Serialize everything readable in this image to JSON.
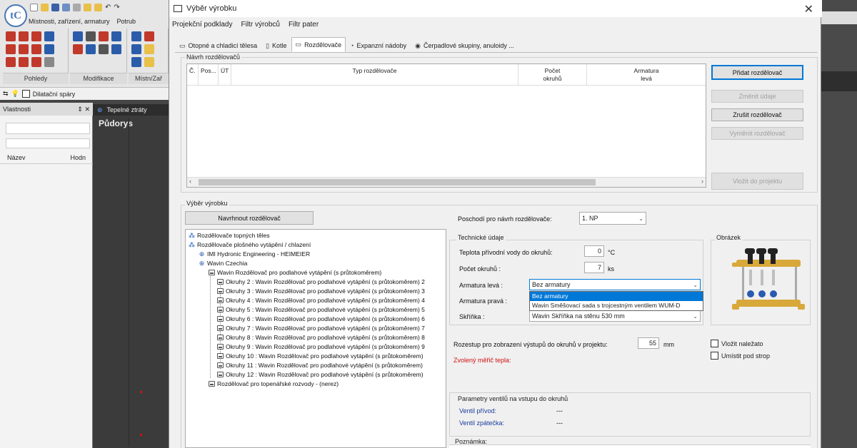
{
  "bg_app": {
    "logo_text": "tC",
    "ribbon_tabs": [
      "Místnosti, zařízení, armatury",
      "Potrub"
    ],
    "ribbon_groups": [
      "Pohledy",
      "Modifikace",
      "Místn/Zař"
    ],
    "toolbar_text": "Dilatační spáry",
    "properties_title": "Vlastnosti",
    "properties_controls": "⇕ ✕",
    "col_name": "Název",
    "col_value": "Hodn",
    "canvas_tab": "Tepelné ztráty",
    "canvas_title": "Půdorys"
  },
  "dialog": {
    "title": "Výběr výrobku",
    "close": "✕",
    "menu": [
      "Projekční podklady",
      "Filtr výrobců",
      "Filtr pater"
    ],
    "tabs": [
      {
        "label": "Otopné a chladicí tělesa",
        "icon": "radiator-icon"
      },
      {
        "label": "Kotle",
        "icon": "boiler-icon"
      },
      {
        "label": "Rozdělovače",
        "icon": "manifold-icon"
      },
      {
        "label": "Expanzní nádoby",
        "icon": "expansion-tank-icon"
      },
      {
        "label": "Čerpadlové skupiny, anuloidy ...",
        "icon": "pump-icon"
      }
    ]
  },
  "navrh": {
    "label": "Návrh rozdělovačů",
    "columns": [
      {
        "label": "Č."
      },
      {
        "label": "Pos..."
      },
      {
        "label": "ÚT"
      },
      {
        "label": "Typ rozdělovače"
      },
      {
        "label": "Počet\nokruhů"
      },
      {
        "label": "Armatura\nlevá"
      }
    ],
    "buttons": {
      "add": "Přidat rozdělovač",
      "change": "Změnit údaje",
      "cancel": "Zrušit rozdělovač",
      "replace": "Vyměnit rozdělovač",
      "insert": "Vložit do projektu"
    }
  },
  "vyber": {
    "label": "Výběr výrobku",
    "suggest_button": "Navrhnout rozdělovač",
    "tree": {
      "root1": "Rozdělovače topných těles",
      "root2": "Rozdělovače plošného vytápění / chlazení",
      "maker1": "IMI Hydronic Engineering - HEIMEIER",
      "maker2": "Wavin Czechia",
      "series": "Wavin Rozdělovač pro podlahové vytápění (s průtokoměrem)",
      "items": [
        "Okruhy 2 : Wavin Rozdělovač pro podlahové vytápění (s průtokoměrem) 2",
        "Okruhy 3 : Wavin Rozdělovač pro podlahové vytápění (s průtokoměrem) 3",
        "Okruhy 4 : Wavin Rozdělovač pro podlahové vytápění (s průtokoměrem) 4",
        "Okruhy 5 : Wavin Rozdělovač pro podlahové vytápění (s průtokoměrem) 5",
        "Okruhy 6 : Wavin Rozdělovač pro podlahové vytápění (s průtokoměrem) 6",
        "Okruhy 7 : Wavin Rozdělovač pro podlahové vytápění (s průtokoměrem) 7",
        "Okruhy 8 : Wavin Rozdělovač pro podlahové vytápění (s průtokoměrem) 8",
        "Okruhy 9 : Wavin Rozdělovač pro podlahové vytápění (s průtokoměrem) 9",
        "Okruhy 10 : Wavin Rozdělovač pro podlahové vytápění (s průtokoměrem)",
        "Okruhy 11 : Wavin Rozdělovač pro podlahové vytápění (s průtokoměrem)",
        "Okruhy 12 : Wavin Rozdělovač pro podlahové vytápění (s průtokoměrem)"
      ],
      "series2": "Rozdělovač pro topenářské rozvody - (nerez)"
    }
  },
  "settings": {
    "floor_label": "Poschodí pro návrh rozdělovače:",
    "floor_value": "1. NP",
    "tech_label": "Technické údaje",
    "temp_label": "Teplota přívodní vody do okruhů:",
    "temp_value": "0",
    "temp_unit": "°C",
    "count_label": "Počet okruhů :",
    "count_value": "7",
    "count_unit": "ks",
    "arm_left_label": "Armatura levá :",
    "arm_left_value": "Bez armatury",
    "arm_right_label": "Armatura pravá :",
    "cabinet_label": "Skříňka :",
    "cabinet_value": "Wavin Skříňka na stěnu 530 mm",
    "dropdown_options": [
      "Bez armatury",
      "Wavin Směšovací sada s trojcestným ventilem WUM-D"
    ],
    "image_label": "Obrázek",
    "spacing_label": "Rozestup pro zobrazení výstupů do okruhů v projektu:",
    "spacing_value": "55",
    "spacing_unit": "mm",
    "chk_lying": "Vložit naležato",
    "chk_ceiling": "Umístit pod strop",
    "heat_meter": "Zvolený měřič tepla:",
    "valves_title": "Parametry ventilů na vstupu do okruhů",
    "valve_supply_label": "Ventil přívod:",
    "valve_supply_value": "---",
    "valve_return_label": "Ventil zpátečka:",
    "valve_return_value": "---",
    "note_label": "Poznámka:"
  },
  "colors": {
    "accent": "#0078d7",
    "warning": "#d01010",
    "link": "#1a3a9c"
  }
}
